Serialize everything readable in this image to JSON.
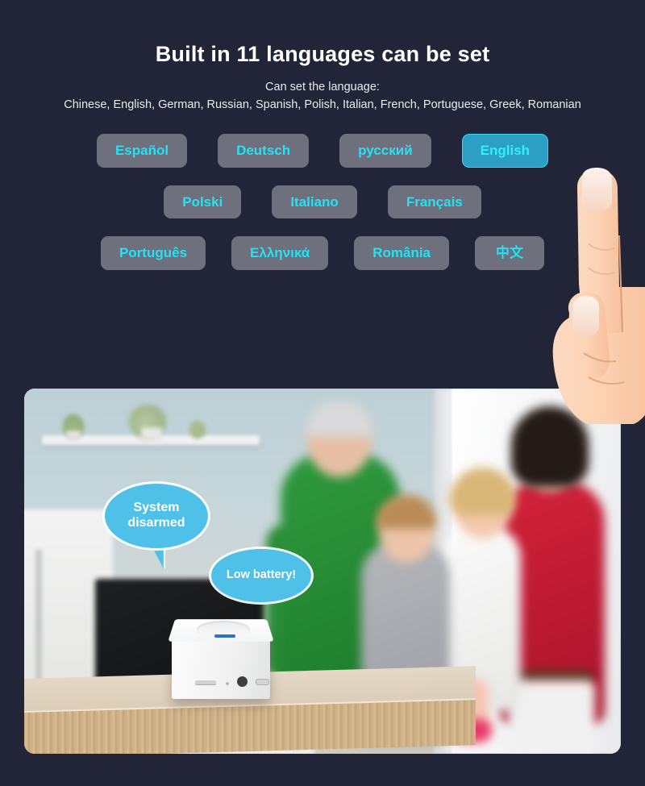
{
  "header": {
    "title": "Built in 11 languages can be set",
    "subtitle_label": "Can set the language:",
    "subtitle_list": "Chinese, English, German, Russian, Spanish, Polish, Italian, French, Portuguese, Greek, Romanian"
  },
  "colors": {
    "background": "#222537",
    "button_bg": "#6f707d",
    "button_text": "#22e2f5",
    "selected_bg": "#2e9fc4",
    "selected_border": "#34d9ee",
    "bubble_bg": "#4fc1e9",
    "title_text": "#ffffff"
  },
  "languages": {
    "row1": [
      {
        "label": "Español",
        "selected": false
      },
      {
        "label": "Deutsch",
        "selected": false
      },
      {
        "label": "русский",
        "selected": false
      },
      {
        "label": "English",
        "selected": true
      }
    ],
    "row2": [
      {
        "label": "Polski",
        "selected": false
      },
      {
        "label": "Italiano",
        "selected": false
      },
      {
        "label": "Français",
        "selected": false
      }
    ],
    "row3": [
      {
        "label": "Português",
        "selected": false
      },
      {
        "label": "Ελληνικά",
        "selected": false
      },
      {
        "label": "România",
        "selected": false
      },
      {
        "label": "中文",
        "selected": false
      }
    ]
  },
  "photo": {
    "bubbles": [
      {
        "text": "System disarmed"
      },
      {
        "text": "Low battery!"
      }
    ]
  },
  "pointer": {
    "icon": "pointing-hand-icon",
    "targets": "English"
  }
}
